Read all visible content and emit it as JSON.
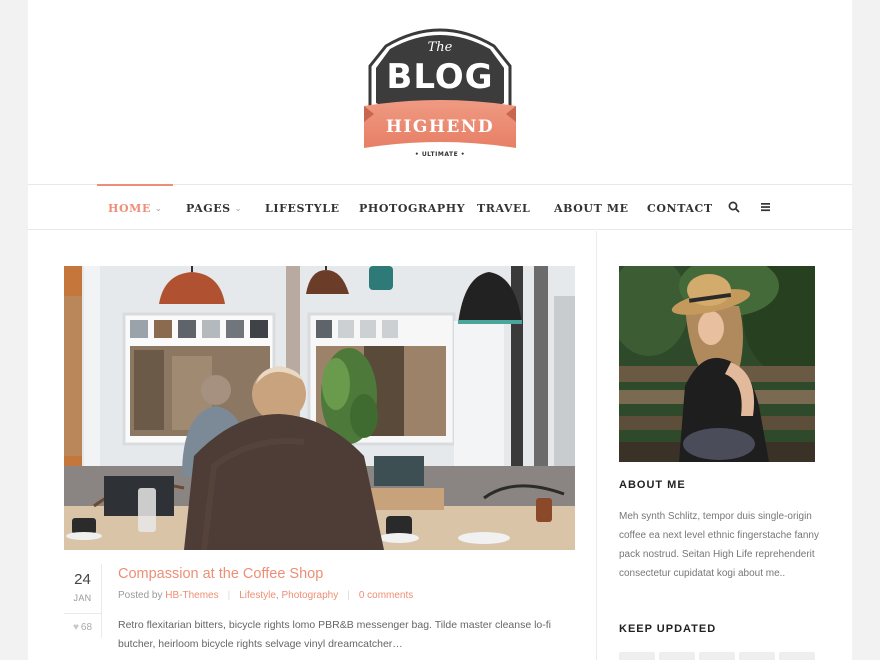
{
  "logo": {
    "the": "The",
    "blog": "BLOG",
    "ribbon": "HIGHEND",
    "sub": "• ULTIMATE •"
  },
  "nav": {
    "items": [
      {
        "label": "HOME",
        "active": true,
        "caret": "⌄"
      },
      {
        "label": "PAGES",
        "active": false,
        "caret": "⌄"
      },
      {
        "label": "LIFESTYLE",
        "active": false
      },
      {
        "label": "PHOTOGRAPHY",
        "active": false
      },
      {
        "label": "TRAVEL",
        "active": false
      },
      {
        "label": "ABOUT ME",
        "active": false
      },
      {
        "label": "CONTACT",
        "active": false
      }
    ],
    "icons": [
      "search-icon",
      "menu-icon"
    ]
  },
  "post": {
    "day": "24",
    "month": "JAN",
    "likes": "68",
    "title": "Compassion at the Coffee Shop",
    "posted_by": "Posted by",
    "author": "HB-Themes",
    "category1": "Lifestyle",
    "category2": "Photography",
    "comments": "0 comments",
    "excerpt": "Retro flexitarian bitters, bicycle rights lomo PBR&B messenger bag. Tilde master cleanse lo-fi butcher, heirloom bicycle rights selvage vinyl dreamcatcher…"
  },
  "sidebar": {
    "about_title": "ABOUT ME",
    "about_text": "Meh synth Schlitz, tempor duis single-origin coffee ea next level ethnic fingerstache fanny pack nostrud. Seitan High Life reprehenderit consectetur cupidatat kogi about me..",
    "keep_updated_title": "KEEP UPDATED"
  },
  "colors": {
    "accent": "#ee8e76",
    "logo_dark": "#3c3c3c",
    "text": "#555555"
  }
}
